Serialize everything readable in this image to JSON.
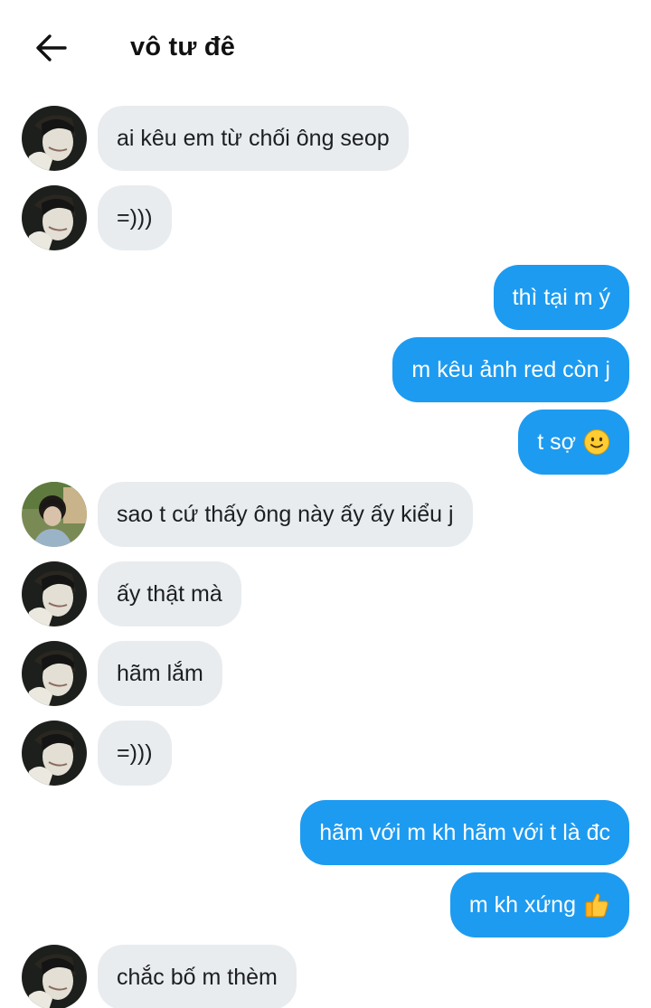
{
  "header": {
    "title": "vô tư đê",
    "back_icon": "arrow-left-icon"
  },
  "colors": {
    "outgoing_bubble": "#1d9bf0",
    "incoming_bubble": "#e9ecef",
    "background": "#ffffff"
  },
  "messages": [
    {
      "direction": "incoming",
      "avatar": "avatar-pale",
      "text": "ai kêu em từ chối ông seop"
    },
    {
      "direction": "incoming",
      "avatar": "avatar-pale",
      "text": "=)))"
    },
    {
      "direction": "outgoing",
      "text": "thì tại m ý"
    },
    {
      "direction": "outgoing",
      "text": "m kêu ảnh red còn j"
    },
    {
      "direction": "outgoing",
      "text": "t sợ",
      "emoji": "slightly-smiling-face-icon"
    },
    {
      "direction": "incoming",
      "avatar": "avatar-outdoor",
      "text": "sao t cứ thấy ông này ấy ấy kiểu j"
    },
    {
      "direction": "incoming",
      "avatar": "avatar-pale",
      "text": "ấy thật mà"
    },
    {
      "direction": "incoming",
      "avatar": "avatar-pale",
      "text": "hãm lắm"
    },
    {
      "direction": "incoming",
      "avatar": "avatar-pale",
      "text": "=)))"
    },
    {
      "direction": "outgoing",
      "text": "hãm với m kh hãm với t là đc"
    },
    {
      "direction": "outgoing",
      "text": "m kh xứng",
      "emoji": "thumbs-up-icon"
    },
    {
      "direction": "incoming",
      "avatar": "avatar-pale",
      "text": "chắc bố m thèm"
    }
  ]
}
